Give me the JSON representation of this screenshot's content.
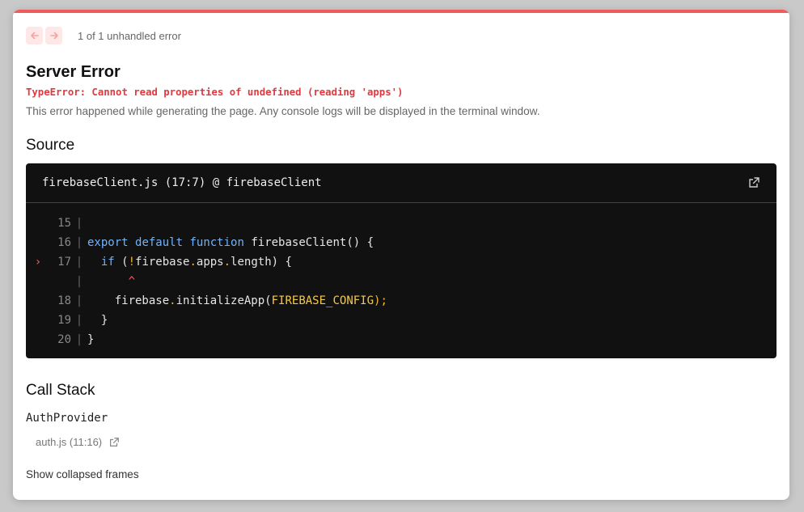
{
  "nav": {
    "prev_icon": "arrow-left-icon",
    "next_icon": "arrow-right-icon",
    "count": "1 of 1 unhandled error"
  },
  "error": {
    "title": "Server Error",
    "message": "TypeError: Cannot read properties of undefined (reading 'apps')",
    "hint": "This error happened while generating the page. Any console logs will be displayed in the terminal window."
  },
  "source": {
    "heading": "Source",
    "file": "firebaseClient.js (17:7) @ firebaseClient",
    "open_icon": "external-link-icon",
    "lines": [
      {
        "marker": "",
        "num": "15",
        "tokens": []
      },
      {
        "marker": "",
        "num": "16",
        "tokens": [
          {
            "t": "export",
            "c": "kw"
          },
          {
            "t": " ",
            "c": "pl"
          },
          {
            "t": "default",
            "c": "kw"
          },
          {
            "t": " ",
            "c": "pl"
          },
          {
            "t": "function",
            "c": "kw"
          },
          {
            "t": " firebaseClient() {",
            "c": "pl"
          }
        ]
      },
      {
        "marker": "›",
        "num": "17",
        "tokens": [
          {
            "t": "  ",
            "c": "pl"
          },
          {
            "t": "if",
            "c": "kw"
          },
          {
            "t": " (",
            "c": "pl"
          },
          {
            "t": "!",
            "c": "op"
          },
          {
            "t": "firebase",
            "c": "pl"
          },
          {
            "t": ".",
            "c": "op"
          },
          {
            "t": "apps",
            "c": "pl"
          },
          {
            "t": ".",
            "c": "op"
          },
          {
            "t": "length) {",
            "c": "pl"
          }
        ]
      },
      {
        "marker": "",
        "num": "",
        "tokens": [
          {
            "t": "      ",
            "c": "pl"
          },
          {
            "t": "^",
            "c": "caret"
          }
        ]
      },
      {
        "marker": "",
        "num": "18",
        "tokens": [
          {
            "t": "    firebase",
            "c": "pl"
          },
          {
            "t": ".",
            "c": "op"
          },
          {
            "t": "initializeApp(",
            "c": "pl"
          },
          {
            "t": "FIREBASE_CONFIG",
            "c": "const"
          },
          {
            "t": ");",
            "c": "op"
          }
        ]
      },
      {
        "marker": "",
        "num": "19",
        "tokens": [
          {
            "t": "  }",
            "c": "pl"
          }
        ]
      },
      {
        "marker": "",
        "num": "20",
        "tokens": [
          {
            "t": "}",
            "c": "pl"
          }
        ]
      }
    ]
  },
  "call_stack": {
    "heading": "Call Stack",
    "frame_function": "AuthProvider",
    "frame_location": "auth.js (11:16)",
    "frame_icon": "external-link-icon",
    "show_collapsed": "Show collapsed frames"
  },
  "colors": {
    "accent": "#ef5b5b",
    "error_text": "#e3393e",
    "code_bg": "#111111",
    "keyword": "#6fb3ff",
    "constant": "#f2c94c"
  }
}
